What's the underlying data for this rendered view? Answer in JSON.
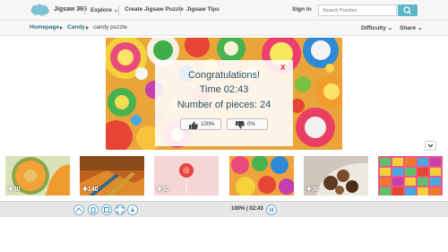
{
  "nav": {
    "brand": "Jigsaw 365",
    "links": [
      "Explore",
      "Create Jigsaw Puzzle",
      "Jigsaw Tips"
    ],
    "signin": "Sign In",
    "search_placeholder": "Search Puzzles"
  },
  "breadcrumb": {
    "items": [
      "Homepage",
      "Candy",
      "candy puzzle"
    ],
    "difficulty": "Difficulty",
    "share": "Share"
  },
  "dialog": {
    "close": "X",
    "title": "Congratulations!",
    "time": "Time 02:43",
    "pieces": "Number of pieces: 24",
    "like": "100%",
    "dislike": "0%"
  },
  "thumbnails": [
    {
      "count": "30",
      "subject": "melon"
    },
    {
      "count": "140",
      "subject": "orange-leaves"
    },
    {
      "count": "30",
      "subject": "lollipop"
    },
    {
      "count": "",
      "subject": "candy"
    },
    {
      "count": "30",
      "subject": "chocolate"
    },
    {
      "count": "",
      "subject": "gummy"
    }
  ],
  "toolbar": {
    "status": "100% | 02:43",
    "buttons": [
      "shuffle-icon",
      "ghost-icon",
      "background-icon",
      "fullscreen-icon",
      "download-icon"
    ]
  },
  "colors": {
    "accent": "#5bb6c8",
    "title_text": "#2b4f64",
    "close": "#d62b2b",
    "link": "#2a6f86"
  }
}
